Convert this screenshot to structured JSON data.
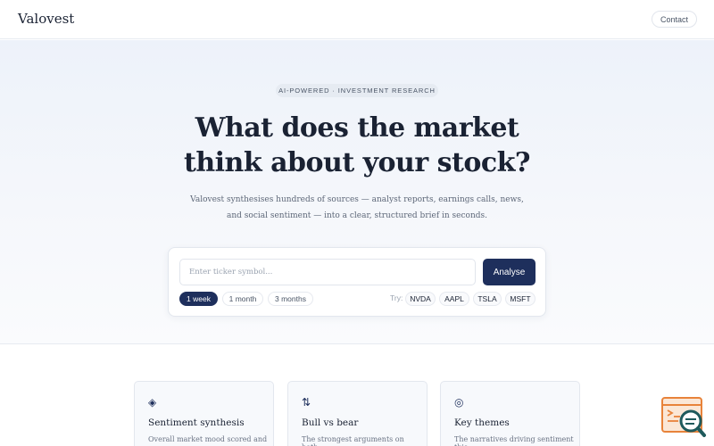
{
  "header": {
    "logo": "Valovest",
    "contact_label": "Contact"
  },
  "hero": {
    "pill": "AI-POWERED · INVESTMENT RESEARCH",
    "headline_lines": [
      "What does the market",
      "think about your stock?"
    ],
    "subtext_lines": [
      "Valovest synthesises hundreds of sources — analyst reports, earnings calls, news,",
      "and social sentiment — into a clear, structured brief in seconds."
    ]
  },
  "search": {
    "placeholder": "Enter ticker symbol...",
    "value": "",
    "analyse_label": "Analyse",
    "periods": [
      {
        "label": "1 week",
        "active": true
      },
      {
        "label": "1 month",
        "active": false
      },
      {
        "label": "3 months",
        "active": false
      }
    ],
    "try_label": "Try:",
    "try_tickers": [
      "NVDA",
      "AAPL",
      "TSLA",
      "MSFT"
    ]
  },
  "features": [
    {
      "icon": "◈",
      "icon_name": "diamond-icon",
      "title": "Sentiment synthesis",
      "desc": "Overall market mood scored and"
    },
    {
      "icon": "⇅",
      "icon_name": "up-down-arrows-icon",
      "title": "Bull vs bear",
      "desc": "The strongest arguments on both"
    },
    {
      "icon": "◎",
      "icon_name": "target-circle-icon",
      "title": "Key themes",
      "desc": "The narratives driving sentiment this"
    }
  ],
  "colors": {
    "brand_navy": "#1e2f5c",
    "widget_orange": "#e8833a",
    "widget_teal": "#1f5a5c"
  }
}
